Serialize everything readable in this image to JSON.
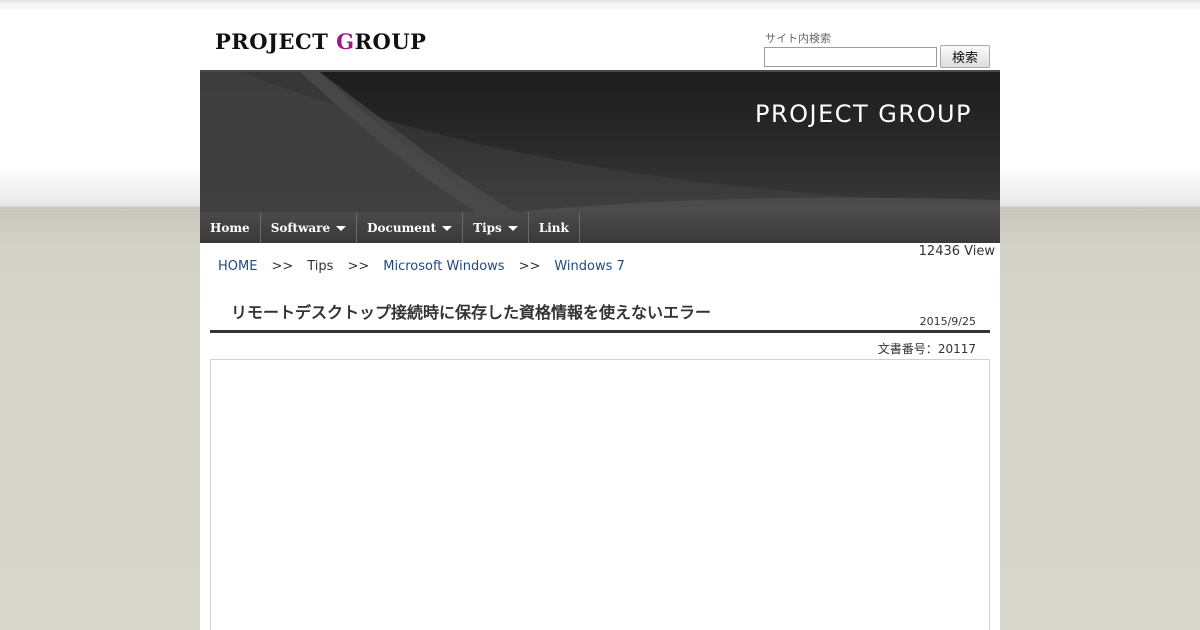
{
  "header": {
    "logo_main": "PROJECT ",
    "logo_accent": "G",
    "logo_rest": "ROUP",
    "search": {
      "label": "サイト内検索",
      "placeholder": "",
      "value": "",
      "button_label": "検索"
    }
  },
  "banner": {
    "title": "PROJECT GROUP"
  },
  "nav": {
    "items": [
      {
        "label": "Home",
        "has_dropdown": false
      },
      {
        "label": "Software",
        "has_dropdown": true
      },
      {
        "label": "Document",
        "has_dropdown": true
      },
      {
        "label": "Tips",
        "has_dropdown": true
      },
      {
        "label": "Link",
        "has_dropdown": false
      }
    ]
  },
  "page": {
    "view_count": "12436 View",
    "breadcrumb": {
      "items": [
        "HOME",
        "Tips",
        "Microsoft Windows",
        "Windows 7"
      ],
      "separator": ">>"
    },
    "title": "リモートデスクトップ接続時に保存した資格情報を使えないエラー",
    "date": "2015/9/25",
    "doc_number_label": "文書番号：",
    "doc_number": "20117"
  },
  "colors": {
    "accent": "#a0168f",
    "link": "#1f4a80",
    "nav_bg": "#404040",
    "page_bg": "#d6d5cb"
  }
}
